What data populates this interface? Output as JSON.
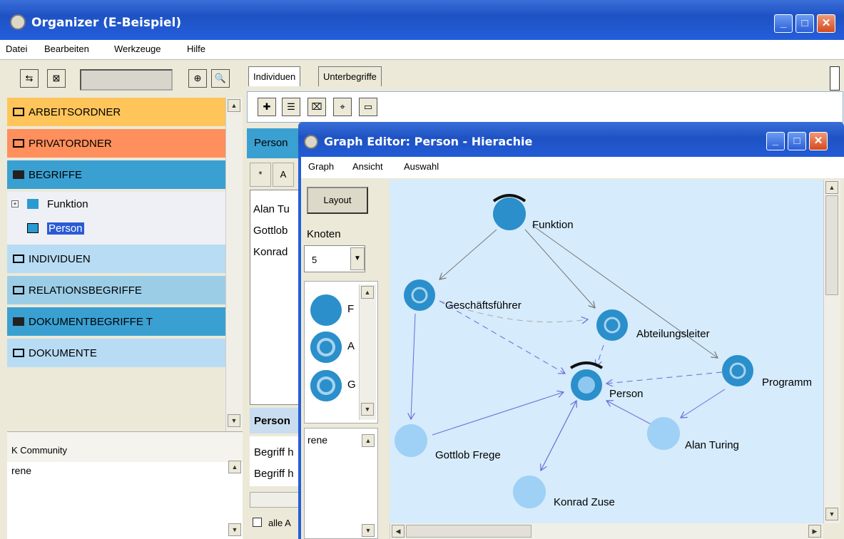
{
  "window": {
    "title": "Organizer (E-Beispiel)"
  },
  "menu": [
    "Datei",
    "Bearbeiten",
    "Werkzeuge",
    "Hilfe"
  ],
  "folders": [
    {
      "label": "ARBEITSORDNER",
      "color": "#ffc55a",
      "icon": "folder-icon"
    },
    {
      "label": "PRIVATORDNER",
      "color": "#ff8f5c",
      "icon": "folder-icon"
    },
    {
      "label": "BEGRIFFE",
      "color": "#3aa0d2",
      "icon": "b-icon"
    },
    {
      "label": "INDIVIDUEN",
      "color": "#b8dcf4",
      "icon": "list-icon"
    },
    {
      "label": "RELATIONSBEGRIFFE",
      "color": "#9ccde6",
      "icon": "list-icon"
    },
    {
      "label": "DOKUMENTBEGRIFFE T",
      "color": "#3aa0d2",
      "icon": "b-icon"
    },
    {
      "label": "DOKUMENTE",
      "color": "#b8dcf4",
      "icon": "folder-icon"
    }
  ],
  "tree": {
    "item1": "Funktion",
    "item2": "Person"
  },
  "community": {
    "label": "K Community",
    "user": "rene"
  },
  "tabs": [
    "Individuen",
    "Unterbegriffe"
  ],
  "middle": {
    "header": "Person",
    "col1": "*",
    "col2": "A",
    "names": [
      "Alan Tu",
      "Gottlob",
      "Konrad"
    ],
    "section": "Person",
    "rows": [
      "Begriff h",
      "Begriff h"
    ],
    "checkbox": "alle A"
  },
  "graph": {
    "title": "Graph Editor: Person - Hierachie",
    "menu": [
      "Graph",
      "Ansicht",
      "Auswahl"
    ],
    "layout_button": "Layout",
    "knoten_label": "Knoten",
    "knoten_value": "5",
    "list_letters": [
      "F",
      "A",
      "G"
    ],
    "user": "rene",
    "nodes": [
      "Funktion",
      "Geschäftsführer",
      "Abteilungsleiter",
      "Programm",
      "Person",
      "Gottlob Frege",
      "Alan Turing",
      "Konrad Zuse"
    ]
  }
}
